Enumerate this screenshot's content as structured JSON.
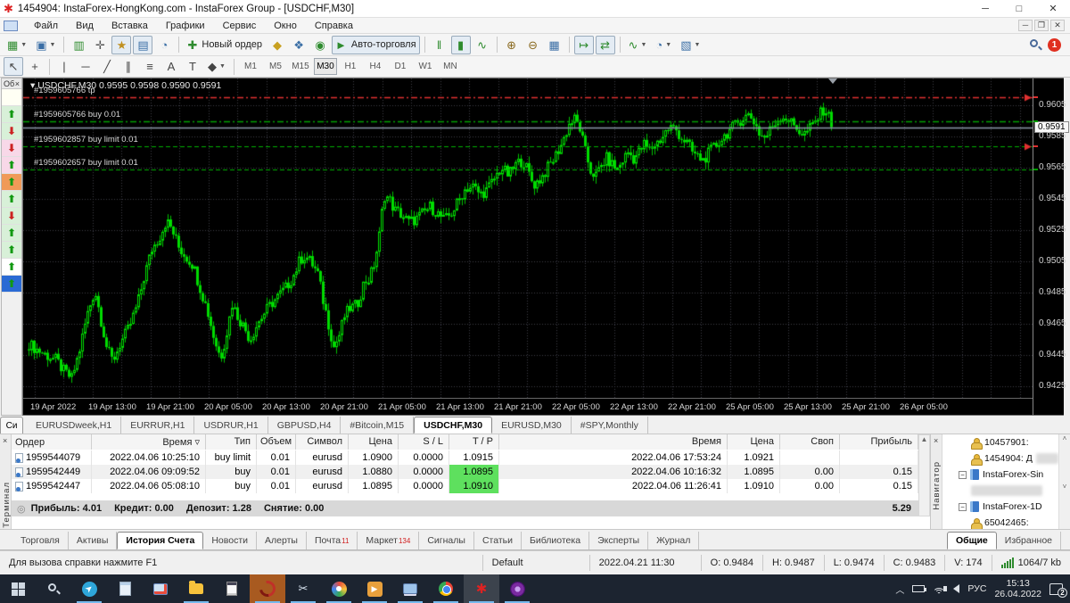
{
  "window": {
    "title": "1454904: InstaForex-HongKong.com - InstaForex Group - [USDCHF,M30]",
    "controls": {
      "minimize": "─",
      "maximize": "□",
      "close": "✕"
    },
    "child_controls": {
      "minimize": "─",
      "restore": "❐",
      "close": "✕"
    }
  },
  "menu": [
    "Файл",
    "Вид",
    "Вставка",
    "Графики",
    "Сервис",
    "Окно",
    "Справка"
  ],
  "toolbar_main": {
    "notification_count": "1",
    "items": [
      {
        "name": "new-chart-button",
        "glyph": "▦",
        "color": "#2e8b2e",
        "dropdown": true
      },
      {
        "name": "profiles-button",
        "glyph": "▣",
        "color": "#3a6ea5",
        "dropdown": true
      },
      {
        "name": "sep"
      },
      {
        "name": "market-watch-button",
        "glyph": "▥",
        "color": "#2e8b2e"
      },
      {
        "name": "data-window-button",
        "glyph": "✛",
        "color": "#555555"
      },
      {
        "name": "navigator-button",
        "glyph": "★",
        "color": "#c09020",
        "pressed": true
      },
      {
        "name": "terminal-button",
        "glyph": "▤",
        "color": "#3a6ea5",
        "pressed": true
      },
      {
        "name": "strategy-tester-button",
        "glyph": "◔",
        "color": "#3a6ea5"
      },
      {
        "name": "sep"
      },
      {
        "name": "new-order-button",
        "glyph": "✚",
        "color": "#2e8b2e",
        "label": "Новый ордер"
      },
      {
        "name": "metaeditor-button",
        "glyph": "◆",
        "color": "#c8a020"
      },
      {
        "name": "experts-button",
        "glyph": "❖",
        "color": "#3a6ea5"
      },
      {
        "name": "news-button",
        "glyph": "◉",
        "color": "#2e8b2e"
      },
      {
        "name": "auto-trading-button",
        "glyph": "►",
        "color": "#2e8b2e",
        "label": "Авто-торговля",
        "pressed": true
      },
      {
        "name": "sep"
      },
      {
        "name": "bar-chart-button",
        "glyph": "‖",
        "color": "#2e8b2e"
      },
      {
        "name": "candle-chart-button",
        "glyph": "▮",
        "color": "#2e8b2e",
        "pressed": true
      },
      {
        "name": "line-chart-button",
        "glyph": "∿",
        "color": "#2e8b2e"
      },
      {
        "name": "sep"
      },
      {
        "name": "zoom-in-button",
        "glyph": "⊕",
        "color": "#8a6a20"
      },
      {
        "name": "zoom-out-button",
        "glyph": "⊖",
        "color": "#8a6a20"
      },
      {
        "name": "tile-windows-button",
        "glyph": "▦",
        "color": "#3a6ea5"
      },
      {
        "name": "sep"
      },
      {
        "name": "autoscroll-button",
        "glyph": "↦",
        "color": "#2e8b2e",
        "pressed": true
      },
      {
        "name": "chart-shift-button",
        "glyph": "⇄",
        "color": "#2e8b2e",
        "pressed": true
      },
      {
        "name": "sep"
      },
      {
        "name": "indicators-button",
        "glyph": "∿",
        "color": "#2e8b2e",
        "dropdown": true
      },
      {
        "name": "periods-button",
        "glyph": "◔",
        "color": "#3a6ea5",
        "dropdown": true
      },
      {
        "name": "templates-button",
        "glyph": "▧",
        "color": "#3a6ea5",
        "dropdown": true
      }
    ]
  },
  "drawing_tools": [
    {
      "name": "cursor-tool",
      "glyph": "↖",
      "pressed": true
    },
    {
      "name": "crosshair-tool",
      "glyph": "+"
    },
    {
      "name": "sep"
    },
    {
      "name": "vertical-line-tool",
      "glyph": "|"
    },
    {
      "name": "horizontal-line-tool",
      "glyph": "─"
    },
    {
      "name": "trendline-tool",
      "glyph": "╱"
    },
    {
      "name": "channel-tool",
      "glyph": "∥"
    },
    {
      "name": "fibonacci-tool",
      "glyph": "≡"
    },
    {
      "name": "text-tool",
      "glyph": "A"
    },
    {
      "name": "label-tool",
      "glyph": "T"
    },
    {
      "name": "arrows-tool",
      "glyph": "◆",
      "dropdown": true
    }
  ],
  "timeframes": {
    "items": [
      "M1",
      "M5",
      "M15",
      "M30",
      "H1",
      "H4",
      "D1",
      "W1",
      "MN"
    ],
    "active": "M30"
  },
  "signals_strip": {
    "header": "Об",
    "close": "×",
    "rows": [
      {
        "bg": "#fffff4",
        "arrow": "",
        "color": ""
      },
      {
        "bg": "#d8f0d8",
        "arrow": "⬆",
        "color": "#119911"
      },
      {
        "bg": "#d8f0d8",
        "arrow": "⬇",
        "color": "#cc2222"
      },
      {
        "bg": "#f8d8e8",
        "arrow": "⬇",
        "color": "#cc2222"
      },
      {
        "bg": "#f8d8e8",
        "arrow": "⬆",
        "color": "#119911"
      },
      {
        "bg": "#f09a58",
        "arrow": "⬆",
        "color": "#119911"
      },
      {
        "bg": "#d8f0d8",
        "arrow": "⬆",
        "color": "#119911"
      },
      {
        "bg": "#d8f0d8",
        "arrow": "⬇",
        "color": "#cc2222"
      },
      {
        "bg": "#d8f0d8",
        "arrow": "⬆",
        "color": "#119911"
      },
      {
        "bg": "#d8f0d8",
        "arrow": "⬆",
        "color": "#119911"
      },
      {
        "bg": "#ffffff",
        "arrow": "⬆",
        "color": "#119911"
      },
      {
        "bg": "#2a6ad4",
        "arrow": "⬆",
        "color": "#119911"
      }
    ]
  },
  "chart": {
    "title_line": "USDCHF,M30  0.9595 0.9598 0.9590 0.9591",
    "current_price_label": "0.9591"
  },
  "chart_data": {
    "type": "candlestick",
    "symbol": "USDCHF",
    "period": "M30",
    "ohlc_display": {
      "open": "0.9595",
      "high": "0.9598",
      "low": "0.9590",
      "close": "0.9591"
    },
    "current_price": 0.9591,
    "y_axis": {
      "min": 0.9425,
      "max": 0.9605,
      "tick_step": 0.002,
      "ticks": [
        "0.9605",
        "0.9585",
        "0.9565",
        "0.9545",
        "0.9525",
        "0.9505",
        "0.9485",
        "0.9465",
        "0.9445",
        "0.9425"
      ]
    },
    "x_axis": {
      "labels": [
        "19 Apr 2022",
        "19 Apr 13:00",
        "19 Apr 21:00",
        "20 Apr 05:00",
        "20 Apr 13:00",
        "20 Apr 21:00",
        "21 Apr 05:00",
        "21 Apr 13:00",
        "21 Apr 21:00",
        "22 Apr 05:00",
        "22 Apr 13:00",
        "22 Apr 21:00",
        "25 Apr 05:00",
        "25 Apr 13:00",
        "25 Apr 21:00",
        "26 Apr 05:00"
      ]
    },
    "orders": [
      {
        "id": "#1959605766 tp",
        "price": 0.961,
        "style": "dashdot",
        "color": "#e03030",
        "arrow": true
      },
      {
        "id": "#1959605766 buy 0.01",
        "price": 0.9595,
        "style": "dashdot",
        "color": "#00a000",
        "arrow": false
      },
      {
        "id": "#1959602857 buy limit 0.01",
        "price": 0.9579,
        "style": "dash",
        "color": "#00b000",
        "arrow": true
      },
      {
        "id": "#1959602657 buy limit 0.01",
        "price": 0.9564,
        "style": "dash",
        "color": "#00b000",
        "arrow": false
      }
    ],
    "axis_markers": [
      {
        "price": 0.961,
        "color": "#e03030"
      },
      {
        "price": 0.9595,
        "color": "#00a000"
      },
      {
        "price": 0.9579,
        "color": "#e03030"
      },
      {
        "price": 0.9564,
        "color": "#00a000"
      }
    ],
    "price_anchors": [
      [
        30,
        0.9452
      ],
      [
        46,
        0.9446
      ],
      [
        60,
        0.9442
      ],
      [
        70,
        0.9434
      ],
      [
        78,
        0.943
      ],
      [
        86,
        0.9446
      ],
      [
        95,
        0.947
      ],
      [
        104,
        0.9487
      ],
      [
        110,
        0.947
      ],
      [
        118,
        0.9448
      ],
      [
        124,
        0.9441
      ],
      [
        132,
        0.9452
      ],
      [
        142,
        0.9462
      ],
      [
        152,
        0.9478
      ],
      [
        160,
        0.9497
      ],
      [
        168,
        0.9513
      ],
      [
        176,
        0.952
      ],
      [
        184,
        0.9531
      ],
      [
        190,
        0.9526
      ],
      [
        198,
        0.9514
      ],
      [
        206,
        0.9508
      ],
      [
        214,
        0.9503
      ],
      [
        222,
        0.9488
      ],
      [
        230,
        0.9474
      ],
      [
        238,
        0.9455
      ],
      [
        245,
        0.9443
      ],
      [
        252,
        0.946
      ],
      [
        258,
        0.9478
      ],
      [
        264,
        0.947
      ],
      [
        272,
        0.9462
      ],
      [
        278,
        0.9455
      ],
      [
        286,
        0.9465
      ],
      [
        294,
        0.9472
      ],
      [
        302,
        0.9478
      ],
      [
        310,
        0.9483
      ],
      [
        318,
        0.9488
      ],
      [
        326,
        0.9495
      ],
      [
        334,
        0.9506
      ],
      [
        340,
        0.9509
      ],
      [
        348,
        0.9503
      ],
      [
        354,
        0.9497
      ],
      [
        360,
        0.948
      ],
      [
        366,
        0.9465
      ],
      [
        372,
        0.945
      ],
      [
        378,
        0.9458
      ],
      [
        384,
        0.947
      ],
      [
        390,
        0.9475
      ],
      [
        398,
        0.9477
      ],
      [
        406,
        0.9492
      ],
      [
        412,
        0.9494
      ],
      [
        418,
        0.9505
      ],
      [
        424,
        0.9525
      ],
      [
        428,
        0.9548
      ],
      [
        434,
        0.9545
      ],
      [
        440,
        0.9538
      ],
      [
        448,
        0.9535
      ],
      [
        456,
        0.953
      ],
      [
        464,
        0.9532
      ],
      [
        472,
        0.9536
      ],
      [
        480,
        0.954
      ],
      [
        488,
        0.9536
      ],
      [
        496,
        0.9531
      ],
      [
        504,
        0.9536
      ],
      [
        512,
        0.9544
      ],
      [
        520,
        0.9552
      ],
      [
        528,
        0.9553
      ],
      [
        536,
        0.9548
      ],
      [
        544,
        0.9551
      ],
      [
        552,
        0.9558
      ],
      [
        560,
        0.9565
      ],
      [
        568,
        0.956
      ],
      [
        576,
        0.9567
      ],
      [
        584,
        0.957
      ],
      [
        590,
        0.9562
      ],
      [
        596,
        0.9554
      ],
      [
        604,
        0.9558
      ],
      [
        612,
        0.9565
      ],
      [
        620,
        0.9572
      ],
      [
        628,
        0.9581
      ],
      [
        636,
        0.9593
      ],
      [
        642,
        0.9596
      ],
      [
        648,
        0.959
      ],
      [
        654,
        0.9575
      ],
      [
        660,
        0.9563
      ],
      [
        666,
        0.956
      ],
      [
        672,
        0.9566
      ],
      [
        678,
        0.9571
      ],
      [
        684,
        0.9567
      ],
      [
        690,
        0.9564
      ],
      [
        696,
        0.957
      ],
      [
        702,
        0.9575
      ],
      [
        708,
        0.9571
      ],
      [
        714,
        0.9575
      ],
      [
        720,
        0.958
      ],
      [
        726,
        0.9576
      ],
      [
        732,
        0.958
      ],
      [
        738,
        0.9583
      ],
      [
        744,
        0.9588
      ],
      [
        750,
        0.9591
      ],
      [
        756,
        0.9589
      ],
      [
        762,
        0.9584
      ],
      [
        768,
        0.9581
      ],
      [
        774,
        0.9575
      ],
      [
        780,
        0.9572
      ],
      [
        786,
        0.957
      ],
      [
        792,
        0.9574
      ],
      [
        798,
        0.9578
      ],
      [
        806,
        0.9583
      ],
      [
        814,
        0.9588
      ],
      [
        822,
        0.9592
      ],
      [
        830,
        0.9597
      ],
      [
        838,
        0.9599
      ],
      [
        844,
        0.9594
      ],
      [
        850,
        0.9586
      ],
      [
        856,
        0.9584
      ],
      [
        862,
        0.959
      ],
      [
        868,
        0.9595
      ],
      [
        874,
        0.9598
      ],
      [
        880,
        0.9597
      ],
      [
        886,
        0.9593
      ],
      [
        892,
        0.959
      ],
      [
        898,
        0.9586
      ],
      [
        904,
        0.9589
      ],
      [
        910,
        0.9593
      ],
      [
        916,
        0.9598
      ],
      [
        922,
        0.9603
      ],
      [
        926,
        0.96
      ],
      [
        930,
        0.9591
      ]
    ]
  },
  "chart_tabs": {
    "edge": "Си",
    "items": [
      "EURUSDweek,H1",
      "EURRUR,H1",
      "USDRUR,H1",
      "GBPUSD,H4",
      "#Bitcoin,M15",
      "USDCHF,M30",
      "EURUSD,M30",
      "#SPY,Monthly"
    ],
    "active": "USDCHF,M30"
  },
  "terminal": {
    "vertical_label": "Терминал",
    "close": "×",
    "columns": [
      "Ордер",
      "Время",
      "Тип",
      "Объем",
      "Символ",
      "Цена",
      "S / L",
      "T / P",
      "Время",
      "Цена",
      "Своп",
      "Прибыль"
    ],
    "sort_column": "Время",
    "rows": [
      {
        "order": "1959544079",
        "time": "2022.04.06 10:25:10",
        "type": "buy limit",
        "volume": "0.01",
        "symbol": "eurusd",
        "price": "1.0900",
        "sl": "0.0000",
        "tp": "1.0915",
        "tp_green": false,
        "close_time": "2022.04.06 17:53:24",
        "close_price": "1.0921",
        "swap": "",
        "profit": ""
      },
      {
        "order": "1959542449",
        "time": "2022.04.06 09:09:52",
        "type": "buy",
        "volume": "0.01",
        "symbol": "eurusd",
        "price": "1.0880",
        "sl": "0.0000",
        "tp": "1.0895",
        "tp_green": true,
        "close_time": "2022.04.06 10:16:32",
        "close_price": "1.0895",
        "swap": "0.00",
        "profit": "0.15"
      },
      {
        "order": "1959542447",
        "time": "2022.04.06 05:08:10",
        "type": "buy",
        "volume": "0.01",
        "symbol": "eurusd",
        "price": "1.0895",
        "sl": "0.0000",
        "tp": "1.0910",
        "tp_green": true,
        "close_time": "2022.04.06 11:26:41",
        "close_price": "1.0910",
        "swap": "0.00",
        "profit": "0.15"
      }
    ],
    "summary": {
      "fields": [
        "Прибыль: 4.01",
        "Кредит: 0.00",
        "Депозит: 1.28",
        "Снятие: 0.00"
      ],
      "total": "5.29"
    },
    "tabs": [
      {
        "label": "Торговля"
      },
      {
        "label": "Активы"
      },
      {
        "label": "История Счета",
        "active": true
      },
      {
        "label": "Новости"
      },
      {
        "label": "Алерты"
      },
      {
        "label": "Почта",
        "badge": "11"
      },
      {
        "label": "Маркет",
        "badge": "134"
      },
      {
        "label": "Сигналы"
      },
      {
        "label": "Статьи"
      },
      {
        "label": "Библиотека"
      },
      {
        "label": "Эксперты"
      },
      {
        "label": "Журнал"
      }
    ]
  },
  "navigator": {
    "vertical_label": "Навигатор",
    "close": "×",
    "items": [
      {
        "kind": "account",
        "label": "10457901:",
        "indent": 2
      },
      {
        "kind": "account",
        "label": "1454904: Д",
        "indent": 2,
        "blur_tail": true
      },
      {
        "kind": "server",
        "label": "InstaForex-Sin",
        "indent": 1
      },
      {
        "kind": "blur",
        "indent": 2
      },
      {
        "kind": "server",
        "label": "InstaForex-1D",
        "indent": 1
      },
      {
        "kind": "account",
        "label": "65042465:",
        "indent": 2
      }
    ],
    "tabs": [
      {
        "label": "Общие",
        "active": true
      },
      {
        "label": "Избранное"
      }
    ]
  },
  "statusbar": {
    "help": "Для вызова справки нажмите F1",
    "profile": "Default",
    "datetime": "2022.04.21 11:30",
    "open": "O: 0.9484",
    "high": "H: 0.9487",
    "low": "L: 0.9474",
    "close": "C: 0.9483",
    "volume": "V: 174",
    "traffic": "1064/7 kb"
  },
  "taskbar": {
    "icons": [
      {
        "name": "start-button",
        "kind": "start"
      },
      {
        "name": "search-button",
        "kind": "search"
      },
      {
        "name": "telegram-icon",
        "kind": "telegram",
        "running": true
      },
      {
        "name": "notepad-icon",
        "kind": "notepad"
      },
      {
        "name": "screen-app-icon",
        "kind": "screen"
      },
      {
        "name": "file-explorer-icon",
        "kind": "folder",
        "running": true
      },
      {
        "name": "calculator-icon",
        "kind": "calc"
      },
      {
        "name": "active-app-icon",
        "kind": "swoosh",
        "active": "orange",
        "running": true
      },
      {
        "name": "snipping-tool-icon",
        "kind": "snip",
        "running": true
      },
      {
        "name": "paint-icon",
        "kind": "paint",
        "running": true
      },
      {
        "name": "media-app-icon",
        "kind": "media",
        "running": true
      },
      {
        "name": "remote-desktop-icon",
        "kind": "remote",
        "running": true
      },
      {
        "name": "chrome-icon",
        "kind": "chrome",
        "running": true
      },
      {
        "name": "metatrader-icon",
        "kind": "mt",
        "active": "gray",
        "running": true
      },
      {
        "name": "tor-icon",
        "kind": "tor",
        "running": true
      }
    ],
    "tray": {
      "lang": "РУС",
      "time": "15:13",
      "date": "26.04.2022",
      "badge": "2"
    }
  }
}
